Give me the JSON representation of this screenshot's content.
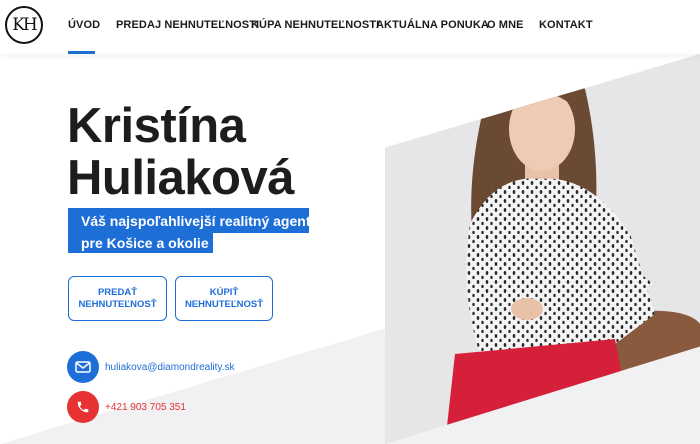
{
  "nav": {
    "items": [
      {
        "label": "ÚVOD",
        "active": true
      },
      {
        "label": "PREDAJ NEHNUTEĽNOSTI",
        "active": false
      },
      {
        "label": "KÚPA NEHNUTEĽNOSTI",
        "active": false
      },
      {
        "label": "AKTUÁLNA PONUKA",
        "active": false
      },
      {
        "label": "O MNE",
        "active": false
      },
      {
        "label": "KONTAKT",
        "active": false
      }
    ],
    "accent": "#1a6fd1"
  },
  "logo": {
    "text": "KH"
  },
  "hero": {
    "name_line1": "Kristína",
    "name_line2": "Huliaková",
    "tagline_line1": "Váš najspoľahlivejší realitný agent",
    "tagline_line2": "pre Košice a okolie"
  },
  "buttons": {
    "sell_line1": "PREDAŤ",
    "sell_line2": "NEHNUTEĽNOSŤ",
    "buy_line1": "KÚPIŤ",
    "buy_line2": "NEHNUTEĽNOSŤ"
  },
  "contact": {
    "email": "huliakova@diamondreality.sk",
    "phone": "+421 903 705 351"
  },
  "colors": {
    "blue": "#1e6ed8",
    "red": "#e63232",
    "dark": "#1d1d1f"
  }
}
